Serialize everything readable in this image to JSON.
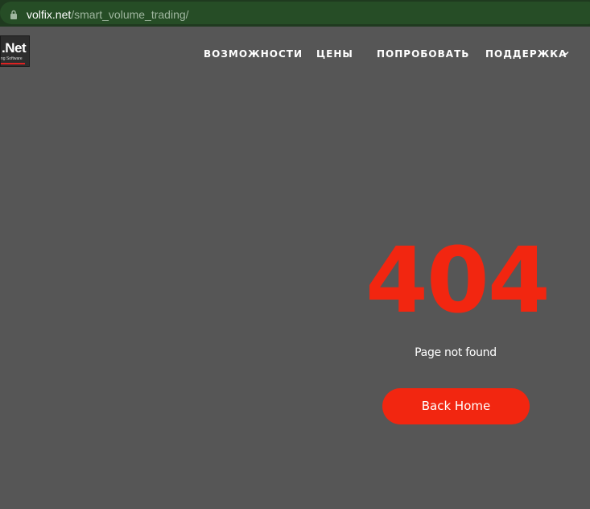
{
  "browser": {
    "url_domain": "volfix.net",
    "url_path": "/smart_volume_trading/"
  },
  "logo": {
    "text": ".Net",
    "subtitle": "ng Software"
  },
  "nav": {
    "items": [
      {
        "label": "ВОЗМОЖНОСТИ"
      },
      {
        "label": "ЦЕНЫ"
      },
      {
        "label": "ПОПРОБОВАТЬ"
      },
      {
        "label": "ПОДДЕРЖКА"
      }
    ]
  },
  "error": {
    "code": "404",
    "message": "Page not found",
    "button_label": "Back Home"
  },
  "colors": {
    "accent": "#f22610",
    "background": "#565656",
    "addressbar": "#264d26"
  },
  "icons": {
    "lock": "lock-icon",
    "dropdown": "chevron-down-icon"
  }
}
